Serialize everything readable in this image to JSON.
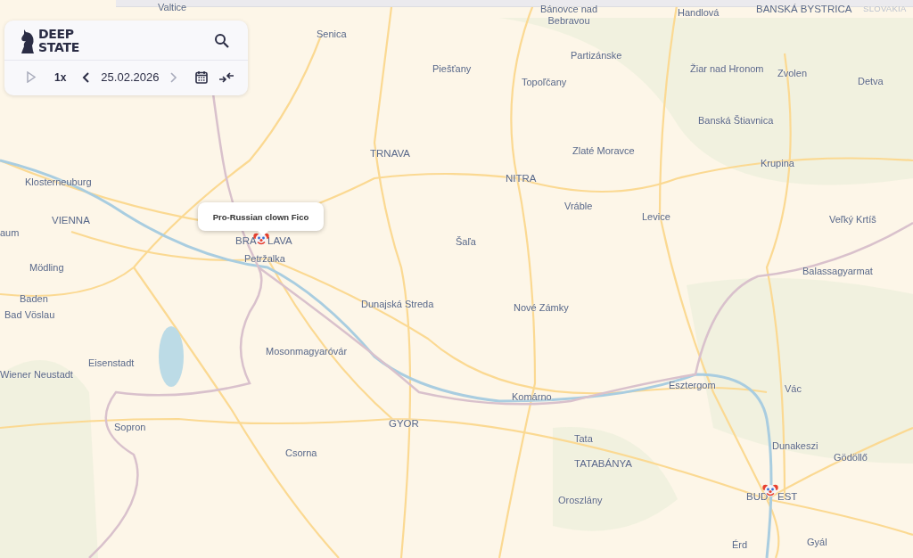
{
  "panel": {
    "logo_lines": [
      "DEEP",
      "STATE"
    ],
    "speed": "1x",
    "date": "25.02.2026",
    "prev_disabled": false,
    "next_disabled": true
  },
  "tooltip": {
    "text": "Pro-Russian clown Fico"
  },
  "markers": [
    {
      "kind": "clown"
    },
    {
      "kind": "clown"
    }
  ],
  "map_labels": [
    {
      "text": "Valtice",
      "kind": "town"
    },
    {
      "text": "Senica",
      "kind": "town"
    },
    {
      "text": "Bánovce nad Bebravou",
      "kind": "town"
    },
    {
      "text": "Handlová",
      "kind": "town"
    },
    {
      "text": "BANSKÁ BYSTRICA",
      "kind": "city"
    },
    {
      "text": "SLOVAKIA",
      "kind": "country"
    },
    {
      "text": "Partizánske",
      "kind": "town"
    },
    {
      "text": "Piešťany",
      "kind": "town"
    },
    {
      "text": "Žiar nad Hronom",
      "kind": "town"
    },
    {
      "text": "Zvolen",
      "kind": "town"
    },
    {
      "text": "Detva",
      "kind": "town"
    },
    {
      "text": "Topoľčany",
      "kind": "town"
    },
    {
      "text": "Banská Štiavnica",
      "kind": "town"
    },
    {
      "text": "TRNAVA",
      "kind": "city"
    },
    {
      "text": "Zlaté Moravce",
      "kind": "town"
    },
    {
      "text": "Krupina",
      "kind": "town"
    },
    {
      "text": "NITRA",
      "kind": "city"
    },
    {
      "text": "Klosterneuburg",
      "kind": "town"
    },
    {
      "text": "Vráble",
      "kind": "town"
    },
    {
      "text": "VIENNA",
      "kind": "city"
    },
    {
      "text": "Levice",
      "kind": "town"
    },
    {
      "text": "Veľký Krtíš",
      "kind": "town"
    },
    {
      "text": "aum",
      "kind": "town"
    },
    {
      "text": "BRA",
      "kind": "city"
    },
    {
      "text": "LAVA",
      "kind": "city"
    },
    {
      "text": "Šaľa",
      "kind": "town"
    },
    {
      "text": "Petržalka",
      "kind": "town"
    },
    {
      "text": "Mödling",
      "kind": "town"
    },
    {
      "text": "Balassagyarmat",
      "kind": "town"
    },
    {
      "text": "Baden",
      "kind": "town"
    },
    {
      "text": "Dunajská Streda",
      "kind": "town"
    },
    {
      "text": "Nové Zámky",
      "kind": "town"
    },
    {
      "text": "Bad Vöslau",
      "kind": "town"
    },
    {
      "text": "Mosonmagyaróvár",
      "kind": "town"
    },
    {
      "text": "Eisenstadt",
      "kind": "town"
    },
    {
      "text": "Wiener Neustadt",
      "kind": "town"
    },
    {
      "text": "Esztergom",
      "kind": "town"
    },
    {
      "text": "Vác",
      "kind": "town"
    },
    {
      "text": "Komárno",
      "kind": "town"
    },
    {
      "text": "Sopron",
      "kind": "town"
    },
    {
      "text": "GYOR",
      "kind": "city"
    },
    {
      "text": "Tata",
      "kind": "town"
    },
    {
      "text": "Csorna",
      "kind": "town"
    },
    {
      "text": "Dunakeszi",
      "kind": "town"
    },
    {
      "text": "Gödöllő",
      "kind": "town"
    },
    {
      "text": "TATABÁNYA",
      "kind": "city"
    },
    {
      "text": "BUD",
      "kind": "city"
    },
    {
      "text": "EST",
      "kind": "city"
    },
    {
      "text": "Oroszlány",
      "kind": "town"
    },
    {
      "text": "Érd",
      "kind": "town"
    },
    {
      "text": "Gyál",
      "kind": "town"
    }
  ]
}
